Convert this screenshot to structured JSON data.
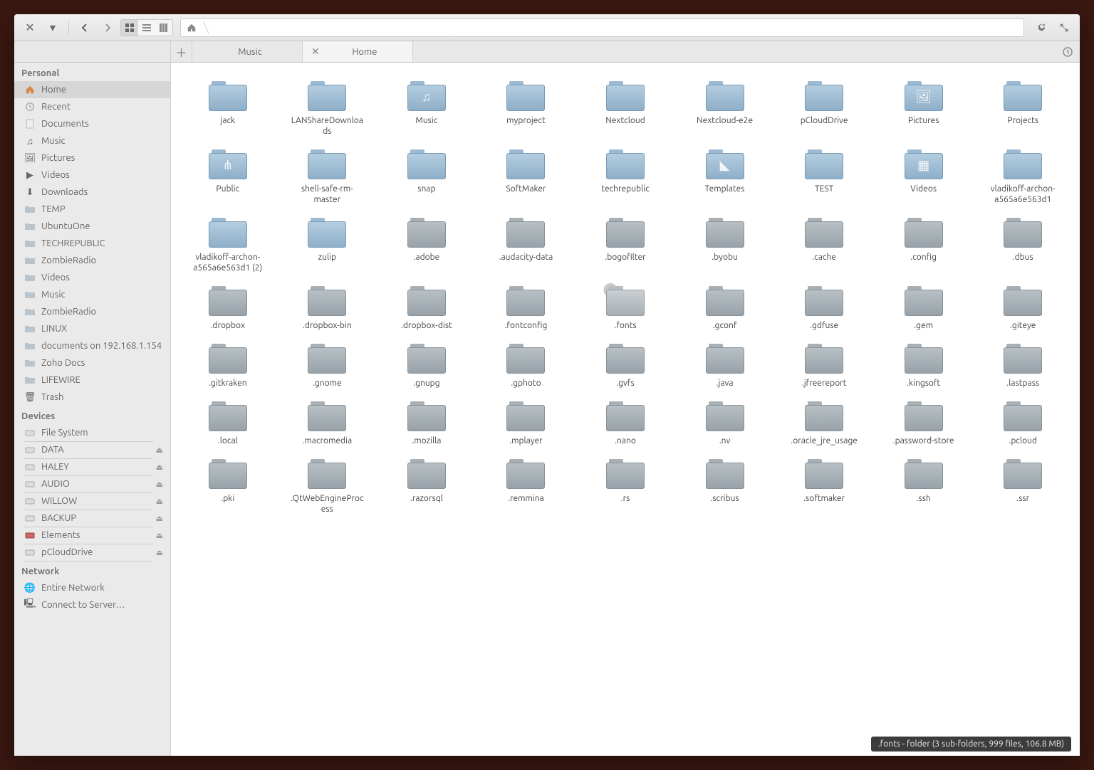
{
  "toolbar": {
    "path_home": "Home"
  },
  "tabs": {
    "items": [
      {
        "label": "Music",
        "active": false,
        "closable": false
      },
      {
        "label": "Home",
        "active": true,
        "closable": true
      }
    ]
  },
  "sidebar": {
    "sections": [
      {
        "title": "Personal",
        "items": [
          {
            "label": "Home",
            "icon": "home",
            "active": true
          },
          {
            "label": "Recent",
            "icon": "recent"
          },
          {
            "label": "Documents",
            "icon": "doc"
          },
          {
            "label": "Music",
            "icon": "music"
          },
          {
            "label": "Pictures",
            "icon": "pic"
          },
          {
            "label": "Videos",
            "icon": "vid"
          },
          {
            "label": "Downloads",
            "icon": "down"
          },
          {
            "label": "TEMP",
            "icon": "folder"
          },
          {
            "label": "UbuntuOne",
            "icon": "folder"
          },
          {
            "label": "TECHREPUBLIC",
            "icon": "folder"
          },
          {
            "label": "ZombieRadio",
            "icon": "folder"
          },
          {
            "label": "Videos",
            "icon": "folder"
          },
          {
            "label": "Music",
            "icon": "folder"
          },
          {
            "label": "ZombieRadio",
            "icon": "folder"
          },
          {
            "label": "LINUX",
            "icon": "folder"
          },
          {
            "label": "documents on 192.168.1.154",
            "icon": "folder"
          },
          {
            "label": "Zoho Docs",
            "icon": "folder"
          },
          {
            "label": "LIFEWIRE",
            "icon": "folder"
          },
          {
            "label": "Trash",
            "icon": "trash"
          }
        ]
      },
      {
        "title": "Devices",
        "items": [
          {
            "label": "File System",
            "icon": "disk",
            "dev": true
          },
          {
            "label": "DATA",
            "icon": "disk",
            "dev": true,
            "eject": true
          },
          {
            "label": "HALEY",
            "icon": "disk",
            "dev": true,
            "eject": true
          },
          {
            "label": "AUDIO",
            "icon": "disk",
            "dev": true,
            "eject": true
          },
          {
            "label": "WILLOW",
            "icon": "disk",
            "dev": true,
            "eject": true
          },
          {
            "label": "BACKUP",
            "icon": "disk",
            "dev": true,
            "eject": true
          },
          {
            "label": "Elements",
            "icon": "diskext",
            "dev": true,
            "eject": true
          },
          {
            "label": "pCloudDrive",
            "icon": "disk",
            "dev": true,
            "eject": true
          }
        ]
      },
      {
        "title": "Network",
        "items": [
          {
            "label": "Entire Network",
            "icon": "net"
          },
          {
            "label": "Connect to Server…",
            "icon": "server"
          }
        ]
      }
    ]
  },
  "folders": [
    {
      "name": "jack",
      "tone": "blue"
    },
    {
      "name": "LANShareDownloads",
      "tone": "blue"
    },
    {
      "name": "Music",
      "tone": "blue",
      "glyph": "♫"
    },
    {
      "name": "myproject",
      "tone": "blue"
    },
    {
      "name": "Nextcloud",
      "tone": "blue"
    },
    {
      "name": "Nextcloud-e2e",
      "tone": "blue"
    },
    {
      "name": "pCloudDrive",
      "tone": "blue"
    },
    {
      "name": "Pictures",
      "tone": "blue",
      "glyph": "🖼"
    },
    {
      "name": "Projects",
      "tone": "blue"
    },
    {
      "name": "Public",
      "tone": "blue",
      "glyph": "⋔"
    },
    {
      "name": "shell-safe-rm-master",
      "tone": "blue"
    },
    {
      "name": "snap",
      "tone": "blue"
    },
    {
      "name": "SoftMaker",
      "tone": "blue"
    },
    {
      "name": "techrepublic",
      "tone": "blue"
    },
    {
      "name": "Templates",
      "tone": "blue",
      "glyph": "◣"
    },
    {
      "name": "TEST",
      "tone": "blue"
    },
    {
      "name": "Videos",
      "tone": "blue",
      "glyph": "▦"
    },
    {
      "name": "vladikoff-archon-a565a6e563d1",
      "tone": "blue"
    },
    {
      "name": "vladikoff-archon-a565a6e563d1 (2)",
      "tone": "blue"
    },
    {
      "name": "zulip",
      "tone": "blue"
    },
    {
      "name": ".adobe",
      "tone": "gray"
    },
    {
      "name": ".audacity-data",
      "tone": "gray"
    },
    {
      "name": ".bogofilter",
      "tone": "gray"
    },
    {
      "name": ".byobu",
      "tone": "gray"
    },
    {
      "name": ".cache",
      "tone": "gray"
    },
    {
      "name": ".config",
      "tone": "gray"
    },
    {
      "name": ".dbus",
      "tone": "gray"
    },
    {
      "name": ".dropbox",
      "tone": "gray"
    },
    {
      "name": ".dropbox-bin",
      "tone": "gray"
    },
    {
      "name": ".dropbox-dist",
      "tone": "gray"
    },
    {
      "name": ".fontconfig",
      "tone": "gray"
    },
    {
      "name": ".fonts",
      "tone": "gray",
      "selected": true
    },
    {
      "name": ".gconf",
      "tone": "gray"
    },
    {
      "name": ".gdfuse",
      "tone": "gray"
    },
    {
      "name": ".gem",
      "tone": "gray"
    },
    {
      "name": ".giteye",
      "tone": "gray"
    },
    {
      "name": ".gitkraken",
      "tone": "gray"
    },
    {
      "name": ".gnome",
      "tone": "gray"
    },
    {
      "name": ".gnupg",
      "tone": "gray"
    },
    {
      "name": ".gphoto",
      "tone": "gray"
    },
    {
      "name": ".gvfs",
      "tone": "gray"
    },
    {
      "name": ".java",
      "tone": "gray"
    },
    {
      "name": ".jfreereport",
      "tone": "gray"
    },
    {
      "name": ".kingsoft",
      "tone": "gray"
    },
    {
      "name": ".lastpass",
      "tone": "gray"
    },
    {
      "name": ".local",
      "tone": "gray"
    },
    {
      "name": ".macromedia",
      "tone": "gray"
    },
    {
      "name": ".mozilla",
      "tone": "gray"
    },
    {
      "name": ".mplayer",
      "tone": "gray"
    },
    {
      "name": ".nano",
      "tone": "gray"
    },
    {
      "name": ".nv",
      "tone": "gray"
    },
    {
      "name": ".oracle_jre_usage",
      "tone": "gray"
    },
    {
      "name": ".password-store",
      "tone": "gray"
    },
    {
      "name": ".pcloud",
      "tone": "gray"
    },
    {
      "name": ".pki",
      "tone": "gray"
    },
    {
      "name": ".QtWebEngineProcess",
      "tone": "gray"
    },
    {
      "name": ".razorsql",
      "tone": "gray"
    },
    {
      "name": ".remmina",
      "tone": "gray"
    },
    {
      "name": ".rs",
      "tone": "gray"
    },
    {
      "name": ".scribus",
      "tone": "gray"
    },
    {
      "name": ".softmaker",
      "tone": "gray"
    },
    {
      "name": ".ssh",
      "tone": "gray"
    },
    {
      "name": ".ssr",
      "tone": "gray"
    }
  ],
  "status": ".fonts - folder (3 sub-folders, 999 files, 106.8 MB)"
}
